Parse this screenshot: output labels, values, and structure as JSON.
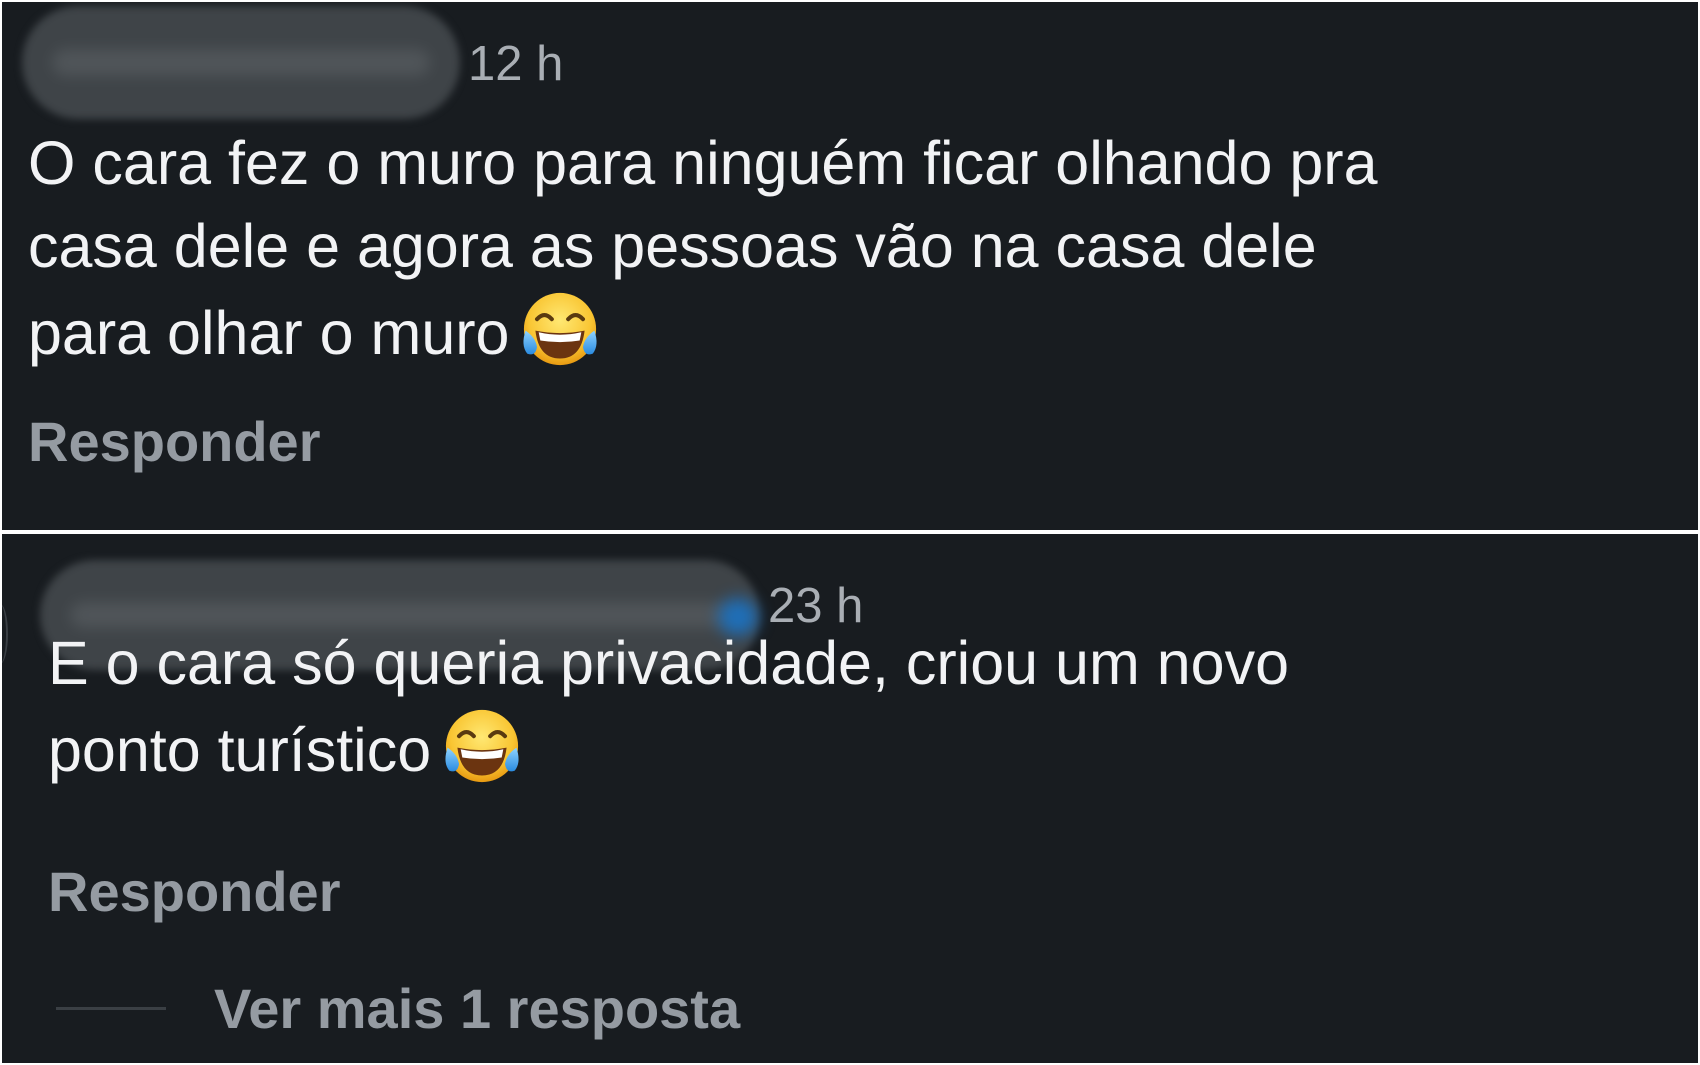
{
  "comments": [
    {
      "time": "12 h",
      "text": "O cara fez o muro para ninguém ficar olhando pra\ncasa dele e agora as pessoas vão na casa dele\npara olhar o muro",
      "emoji": "face-with-tears-of-joy-icon",
      "reply_label": "Responder"
    },
    {
      "time": "23 h",
      "text": "E o cara só queria privacidade, criou um novo\nponto turístico",
      "emoji": "face-with-tears-of-joy-icon",
      "reply_label": "Responder",
      "more_replies_label": "Ver mais 1 resposta"
    }
  ],
  "colors": {
    "background": "#181c20",
    "text": "#f2f3f5",
    "muted": "#959ba2",
    "verified_badge": "#1f6fb8"
  }
}
